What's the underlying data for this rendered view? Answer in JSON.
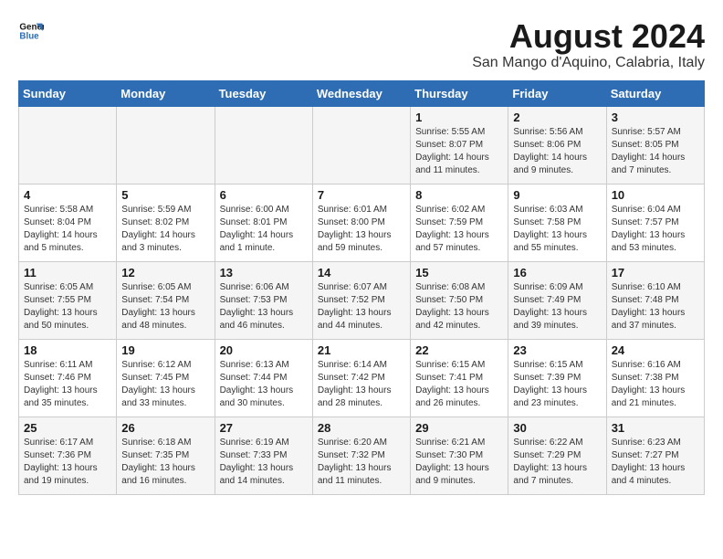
{
  "logo": {
    "line1": "General",
    "line2": "Blue"
  },
  "title": "August 2024",
  "subtitle": "San Mango d'Aquino, Calabria, Italy",
  "days_of_week": [
    "Sunday",
    "Monday",
    "Tuesday",
    "Wednesday",
    "Thursday",
    "Friday",
    "Saturday"
  ],
  "weeks": [
    [
      {
        "day": "",
        "info": ""
      },
      {
        "day": "",
        "info": ""
      },
      {
        "day": "",
        "info": ""
      },
      {
        "day": "",
        "info": ""
      },
      {
        "day": "1",
        "info": "Sunrise: 5:55 AM\nSunset: 8:07 PM\nDaylight: 14 hours and 11 minutes."
      },
      {
        "day": "2",
        "info": "Sunrise: 5:56 AM\nSunset: 8:06 PM\nDaylight: 14 hours and 9 minutes."
      },
      {
        "day": "3",
        "info": "Sunrise: 5:57 AM\nSunset: 8:05 PM\nDaylight: 14 hours and 7 minutes."
      }
    ],
    [
      {
        "day": "4",
        "info": "Sunrise: 5:58 AM\nSunset: 8:04 PM\nDaylight: 14 hours and 5 minutes."
      },
      {
        "day": "5",
        "info": "Sunrise: 5:59 AM\nSunset: 8:02 PM\nDaylight: 14 hours and 3 minutes."
      },
      {
        "day": "6",
        "info": "Sunrise: 6:00 AM\nSunset: 8:01 PM\nDaylight: 14 hours and 1 minute."
      },
      {
        "day": "7",
        "info": "Sunrise: 6:01 AM\nSunset: 8:00 PM\nDaylight: 13 hours and 59 minutes."
      },
      {
        "day": "8",
        "info": "Sunrise: 6:02 AM\nSunset: 7:59 PM\nDaylight: 13 hours and 57 minutes."
      },
      {
        "day": "9",
        "info": "Sunrise: 6:03 AM\nSunset: 7:58 PM\nDaylight: 13 hours and 55 minutes."
      },
      {
        "day": "10",
        "info": "Sunrise: 6:04 AM\nSunset: 7:57 PM\nDaylight: 13 hours and 53 minutes."
      }
    ],
    [
      {
        "day": "11",
        "info": "Sunrise: 6:05 AM\nSunset: 7:55 PM\nDaylight: 13 hours and 50 minutes."
      },
      {
        "day": "12",
        "info": "Sunrise: 6:05 AM\nSunset: 7:54 PM\nDaylight: 13 hours and 48 minutes."
      },
      {
        "day": "13",
        "info": "Sunrise: 6:06 AM\nSunset: 7:53 PM\nDaylight: 13 hours and 46 minutes."
      },
      {
        "day": "14",
        "info": "Sunrise: 6:07 AM\nSunset: 7:52 PM\nDaylight: 13 hours and 44 minutes."
      },
      {
        "day": "15",
        "info": "Sunrise: 6:08 AM\nSunset: 7:50 PM\nDaylight: 13 hours and 42 minutes."
      },
      {
        "day": "16",
        "info": "Sunrise: 6:09 AM\nSunset: 7:49 PM\nDaylight: 13 hours and 39 minutes."
      },
      {
        "day": "17",
        "info": "Sunrise: 6:10 AM\nSunset: 7:48 PM\nDaylight: 13 hours and 37 minutes."
      }
    ],
    [
      {
        "day": "18",
        "info": "Sunrise: 6:11 AM\nSunset: 7:46 PM\nDaylight: 13 hours and 35 minutes."
      },
      {
        "day": "19",
        "info": "Sunrise: 6:12 AM\nSunset: 7:45 PM\nDaylight: 13 hours and 33 minutes."
      },
      {
        "day": "20",
        "info": "Sunrise: 6:13 AM\nSunset: 7:44 PM\nDaylight: 13 hours and 30 minutes."
      },
      {
        "day": "21",
        "info": "Sunrise: 6:14 AM\nSunset: 7:42 PM\nDaylight: 13 hours and 28 minutes."
      },
      {
        "day": "22",
        "info": "Sunrise: 6:15 AM\nSunset: 7:41 PM\nDaylight: 13 hours and 26 minutes."
      },
      {
        "day": "23",
        "info": "Sunrise: 6:15 AM\nSunset: 7:39 PM\nDaylight: 13 hours and 23 minutes."
      },
      {
        "day": "24",
        "info": "Sunrise: 6:16 AM\nSunset: 7:38 PM\nDaylight: 13 hours and 21 minutes."
      }
    ],
    [
      {
        "day": "25",
        "info": "Sunrise: 6:17 AM\nSunset: 7:36 PM\nDaylight: 13 hours and 19 minutes."
      },
      {
        "day": "26",
        "info": "Sunrise: 6:18 AM\nSunset: 7:35 PM\nDaylight: 13 hours and 16 minutes."
      },
      {
        "day": "27",
        "info": "Sunrise: 6:19 AM\nSunset: 7:33 PM\nDaylight: 13 hours and 14 minutes."
      },
      {
        "day": "28",
        "info": "Sunrise: 6:20 AM\nSunset: 7:32 PM\nDaylight: 13 hours and 11 minutes."
      },
      {
        "day": "29",
        "info": "Sunrise: 6:21 AM\nSunset: 7:30 PM\nDaylight: 13 hours and 9 minutes."
      },
      {
        "day": "30",
        "info": "Sunrise: 6:22 AM\nSunset: 7:29 PM\nDaylight: 13 hours and 7 minutes."
      },
      {
        "day": "31",
        "info": "Sunrise: 6:23 AM\nSunset: 7:27 PM\nDaylight: 13 hours and 4 minutes."
      }
    ]
  ]
}
